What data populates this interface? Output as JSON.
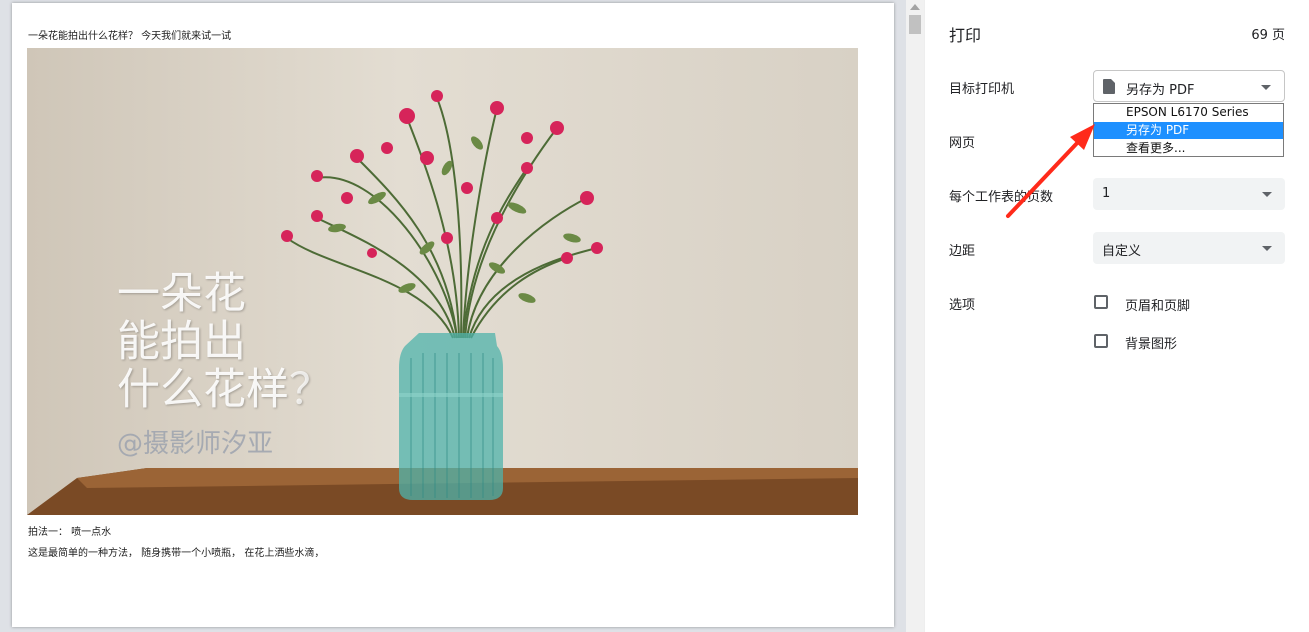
{
  "document": {
    "title": "一朵花能拍出什么花样？ 今天我们就来试一试",
    "image_overlay_line1": "一朵花",
    "image_overlay_line2": "能拍出",
    "image_overlay_line3": "什么花样",
    "image_overlay_qmark": "？",
    "image_credit": "@摄影师汐亚",
    "caption": "拍法一： 喷一点水",
    "body": "这是最简单的一种方法， 随身携带一个小喷瓶， 在花上洒些水滴，"
  },
  "panel": {
    "title": "打印",
    "page_count": "69 页",
    "destination": {
      "label": "目标打印机",
      "value": "另存为 PDF",
      "icon": "document-icon",
      "options": [
        "EPSON L6170 Series",
        "另存为 PDF",
        "查看更多..."
      ],
      "highlighted_option": "另存为 PDF"
    },
    "pages": {
      "label": "网页"
    },
    "pages_per_sheet": {
      "label": "每个工作表的页数",
      "value": "1"
    },
    "margins": {
      "label": "边距",
      "value": "自定义"
    },
    "options": {
      "label": "选项",
      "headers_footers": "页眉和页脚",
      "background_graphics": "背景图形",
      "headers_footers_checked": false,
      "background_graphics_checked": false
    }
  },
  "annotation": {
    "color": "#ff2a1a"
  }
}
